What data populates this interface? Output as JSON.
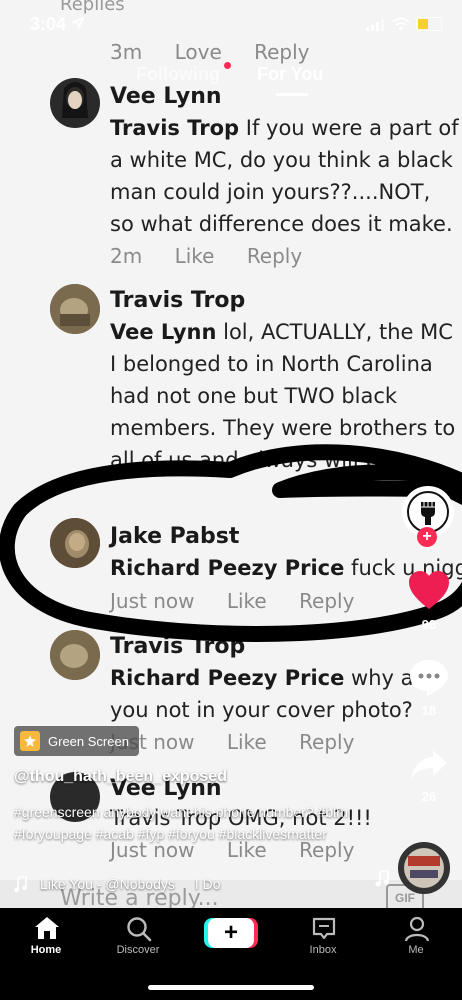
{
  "status_bar": {
    "time": "3:04"
  },
  "top_tabs": {
    "following": "Following",
    "for_you": "For You"
  },
  "video_content": {
    "header": "Replies",
    "comments": [
      {
        "meta": [
          "3m",
          "Love",
          "Reply"
        ]
      },
      {
        "name": "Vee Lynn",
        "mention": "Travis Trop",
        "text": " If you were a part of a white MC, do you think a black man could join yours??....NOT, so what difference does it make.",
        "meta": [
          "2m",
          "Like",
          "Reply"
        ]
      },
      {
        "name": "Travis Trop",
        "mention": "Vee Lynn",
        "text": " lol, ACTUALLY, the MC I belonged to in North Carolina had not one but TWO black members. They were brothers to all of us and always will be."
      },
      {
        "name": "Jake Pabst",
        "mention": "Richard Peezy Price",
        "text": " fuck u nigger",
        "meta": [
          "Just now",
          "Like",
          "Reply"
        ]
      },
      {
        "name": "Travis Trop",
        "mention": "Richard Peezy Price",
        "text": " why are you not in your cover photo?",
        "meta": [
          "Just now",
          "Like",
          "Reply"
        ]
      },
      {
        "name": "Vee Lynn",
        "text": "Travis Trop OMG, not 2!!!",
        "meta": [
          "Just now",
          "Like",
          "Reply"
        ]
      }
    ],
    "write_reply_placeholder": "Write a reply...",
    "gif_label": "GIF"
  },
  "right_rail": {
    "like_count": "98",
    "comment_count": "18",
    "share_count": "26"
  },
  "caption": {
    "effect_label": "Green Screen",
    "username": "@thou_hath_been_exposed",
    "text": "#greenscreen anybody want his phone number? #blm #foryoupage #acab #fyp #foryou #blacklivesmatter",
    "sound": "Like You - @Nobodys",
    "sound_tail": "I Do"
  },
  "bottom_nav": {
    "home": "Home",
    "discover": "Discover",
    "create": "+",
    "inbox": "Inbox",
    "me": "Me"
  },
  "colors": {
    "accent": "#fe2c55",
    "like": "#ee1d52",
    "active": "#ffffff",
    "inactive": "#bbbbbb"
  }
}
